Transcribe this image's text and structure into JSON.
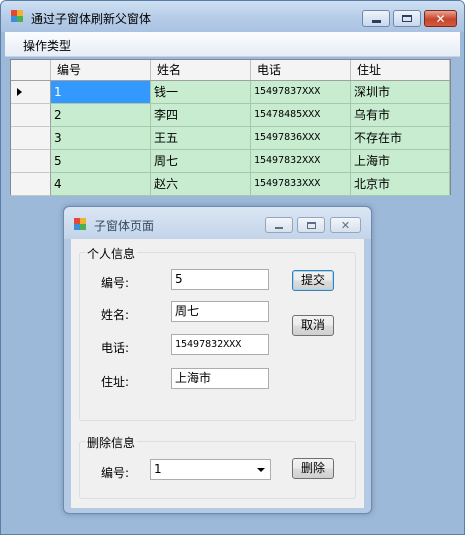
{
  "window": {
    "title": "通过子窗体刷新父窗体",
    "controls": {
      "minimize_icon": "minimize-icon",
      "maximize_icon": "maximize-icon",
      "close_icon": "close-icon"
    }
  },
  "menu": {
    "items": [
      {
        "label": "操作类型"
      }
    ]
  },
  "grid": {
    "columns": [
      "编号",
      "姓名",
      "电话",
      "住址"
    ],
    "rows": [
      {
        "id": "1",
        "name": "钱一",
        "phone": "15497837XXX",
        "address": "深圳市"
      },
      {
        "id": "2",
        "name": "李四",
        "phone": "15478485XXX",
        "address": "乌有市"
      },
      {
        "id": "3",
        "name": "王五",
        "phone": "15497836XXX",
        "address": "不存在市"
      },
      {
        "id": "5",
        "name": "周七",
        "phone": "15497832XXX",
        "address": "上海市"
      },
      {
        "id": "4",
        "name": "赵六",
        "phone": "15497833XXX",
        "address": "北京市"
      }
    ],
    "selected_row": 0,
    "current_row_icon": "row-pointer-icon"
  },
  "child": {
    "title": "子窗体页面",
    "personal_group": {
      "legend": "个人信息",
      "id_label": "编号:",
      "id_value": "5",
      "name_label": "姓名:",
      "name_value": "周七",
      "phone_label": "电话:",
      "phone_value": "15497832XXX",
      "address_label": "住址:",
      "address_value": "上海市",
      "submit_label": "提交",
      "cancel_label": "取消"
    },
    "delete_group": {
      "legend": "删除信息",
      "id_label": "编号:",
      "id_selected": "1",
      "delete_label": "删除"
    }
  },
  "colors": {
    "row_green": "#c8eccf",
    "selection_blue": "#3399ff",
    "desktop_blue": "#9db9d9",
    "close_red": "#c6452d"
  }
}
